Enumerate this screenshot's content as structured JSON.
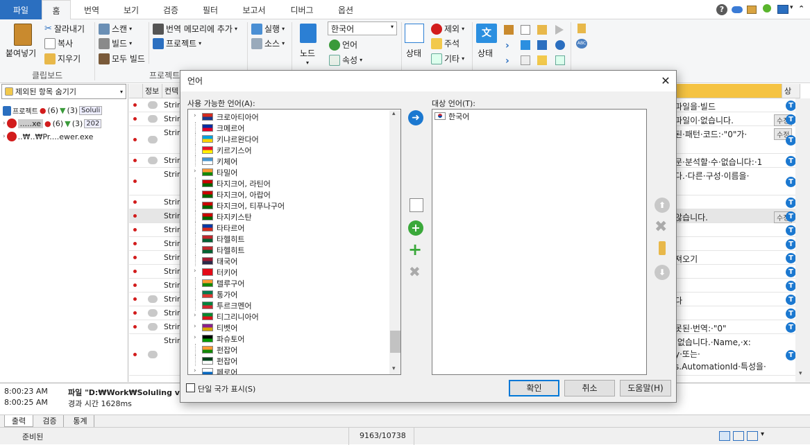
{
  "ribbon_tabs": [
    "파일",
    "홈",
    "번역",
    "보기",
    "검증",
    "필터",
    "보고서",
    "디버그",
    "옵션"
  ],
  "ribbon": {
    "paste_label": "붙여넣기",
    "cut_label": "잘라내기",
    "copy_label": "복사",
    "clear_label": "지우기",
    "clipboard_group": "클립보드",
    "scan_label": "스캔",
    "build_label": "빌드",
    "build_all_label": "모두 빌드",
    "project_group": "프로젝트",
    "tm_add_label": "번역 메모리에 추가",
    "project_label": "프로젝트",
    "run_label": "실행",
    "source_label": "소스",
    "node_label": "노드",
    "language_combo": "한국어",
    "language_label": "언어",
    "property_label": "속성",
    "status_label": "상태",
    "exclude_label": "제외",
    "comment_label": "주석",
    "other_label": "기타",
    "status2_label": "상태"
  },
  "left": {
    "filter_label": "제외된 항목 숨기기",
    "tree": [
      {
        "label": "프로젝트",
        "count": "(6)",
        "extra": "(3)",
        "tag": "Soluli"
      },
      {
        "label": ".....xe",
        "count": "(6)",
        "extra": "(3)",
        "tag": "202"
      },
      {
        "label": "..₩..₩Pr....ewer.exe",
        "count": "",
        "extra": "",
        "tag": ""
      }
    ]
  },
  "grid": {
    "headers": [
      "정보",
      "컨텍"
    ],
    "right_header": "상",
    "rows": [
      {
        "str": "Strin",
        "text": "파일을·빌드",
        "badge": "",
        "comment": true
      },
      {
        "str": "Strin",
        "text": "파일이·없습니다.",
        "badge": "수정",
        "comment": true
      },
      {
        "str": "Strin",
        "text": "된·패턴·코드:·\"0\"가·",
        "badge": "수정",
        "comment": true
      },
      {
        "str": "Strin",
        "text": "문·분석할·수·없습니다:·1",
        "badge": "",
        "comment": true
      },
      {
        "str": "Strin",
        "text": "다.·다른·구성·이름을·",
        "badge": "",
        "comment": false
      },
      {
        "str": "Strin",
        "text": "",
        "badge": "",
        "comment": false
      },
      {
        "str": "Strin",
        "text": "않습니다.",
        "badge": "수정",
        "comment": false
      },
      {
        "str": "Strin",
        "text": "",
        "badge": "",
        "comment": false
      },
      {
        "str": "Strin",
        "text": "",
        "badge": "",
        "comment": false
      },
      {
        "str": "Strin",
        "text": "져오기",
        "badge": "",
        "comment": false
      },
      {
        "str": "Strin",
        "text": "",
        "badge": "",
        "comment": false
      },
      {
        "str": "Strin",
        "text": "",
        "badge": "",
        "comment": false
      },
      {
        "str": "Strin",
        "text": "다",
        "badge": "",
        "comment": true
      },
      {
        "str": "Strin",
        "text": "",
        "badge": "",
        "comment": true
      },
      {
        "str": "Strin",
        "text": "못된·번역:·\"0\"",
        "badge": "",
        "comment": true
      },
      {
        "str": "Strin",
        "text": "·없습니다.·Name,·x:",
        "badge": "",
        "comment": true
      }
    ],
    "extra_lines": [
      "y·또는·",
      "s.AutomationId·특성을·"
    ]
  },
  "output": {
    "lines": [
      {
        "time": "8:00:23 AM",
        "text": "파일 \"D:₩Work₩Soluling v.1."
      },
      {
        "time": "8:00:25 AM",
        "text": "경과 시간 1628ms"
      }
    ],
    "tabs": [
      "출력",
      "검증",
      "통계"
    ]
  },
  "status": {
    "left": "준비된",
    "count": "9163/10738"
  },
  "dialog": {
    "title": "언어",
    "available_label": "사용 가능한 언어(A):",
    "target_label": "대상 언어(T):",
    "languages": [
      {
        "name": "크로아티아어",
        "exp": true,
        "c1": "#d52b1e",
        "c2": "#1b3a8b"
      },
      {
        "name": "크메르어",
        "exp": false,
        "c1": "#032ea1",
        "c2": "#e00025"
      },
      {
        "name": "키냐르완다어",
        "exp": false,
        "c1": "#00a1de",
        "c2": "#fad201"
      },
      {
        "name": "키르기스어",
        "exp": false,
        "c1": "#e8112d",
        "c2": "#ffef00"
      },
      {
        "name": "키체어",
        "exp": false,
        "c1": "#4997d0",
        "c2": "#ffffff"
      },
      {
        "name": "타밀어",
        "exp": true,
        "c1": "#ff9933",
        "c2": "#138808"
      },
      {
        "name": "타지크어, 라틴어",
        "exp": false,
        "c1": "#cc0000",
        "c2": "#006600"
      },
      {
        "name": "타지크어, 아랍어",
        "exp": false,
        "c1": "#cc0000",
        "c2": "#006600"
      },
      {
        "name": "타지크어, 티푸나구어",
        "exp": false,
        "c1": "#cc0000",
        "c2": "#006600"
      },
      {
        "name": "타지키스탄",
        "exp": false,
        "c1": "#cc0000",
        "c2": "#006600"
      },
      {
        "name": "타타르어",
        "exp": false,
        "c1": "#0039a6",
        "c2": "#d52b1e"
      },
      {
        "name": "타헬히트",
        "exp": false,
        "c1": "#c1272d",
        "c2": "#006233"
      },
      {
        "name": "타헬히트",
        "exp": false,
        "c1": "#c1272d",
        "c2": "#006233"
      },
      {
        "name": "태국어",
        "exp": false,
        "c1": "#a51931",
        "c2": "#2d2a4a"
      },
      {
        "name": "터키어",
        "exp": true,
        "c1": "#e30a17",
        "c2": "#e30a17"
      },
      {
        "name": "텔루구어",
        "exp": false,
        "c1": "#ff9933",
        "c2": "#138808"
      },
      {
        "name": "통가어",
        "exp": false,
        "c1": "#007a4d",
        "c2": "#de3831"
      },
      {
        "name": "투르크멘어",
        "exp": false,
        "c1": "#00843d",
        "c2": "#d22630"
      },
      {
        "name": "티그리니아어",
        "exp": true,
        "c1": "#078930",
        "c2": "#da121a"
      },
      {
        "name": "티벳어",
        "exp": true,
        "c1": "#8a1f8c",
        "c2": "#d6a600"
      },
      {
        "name": "파슈토어",
        "exp": true,
        "c1": "#000000",
        "c2": "#009900"
      },
      {
        "name": "펀잡어",
        "exp": false,
        "c1": "#ff9933",
        "c2": "#138808"
      },
      {
        "name": "펀잡어",
        "exp": false,
        "c1": "#01411c",
        "c2": "#ffffff"
      },
      {
        "name": "페로어",
        "exp": true,
        "c1": "#ffffff",
        "c2": "#0065bd"
      }
    ],
    "target_languages": [
      "한국어"
    ],
    "single_country_label": "단일 국가 표시(S)",
    "ok_label": "확인",
    "cancel_label": "취소",
    "help_label": "도움말(H)"
  },
  "colors": {
    "accent": "#2b6fc0",
    "dot": "#d21c1c",
    "badge": "#1b78d0",
    "header_orange": "#f5c342"
  }
}
